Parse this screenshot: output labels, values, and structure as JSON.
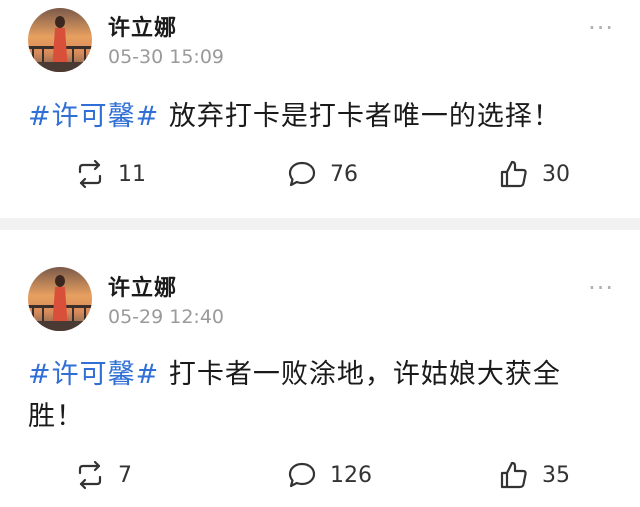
{
  "posts": [
    {
      "author": "许立娜",
      "time": "05-30 15:09",
      "more_icon": "more-dots-icon",
      "hashtag": "#许可馨#",
      "text": " 放弃打卡是打卡者唯一的选择！",
      "repost_count": "11",
      "comment_count": "76",
      "like_count": "30"
    },
    {
      "author": "许立娜",
      "time": "05-29 12:40",
      "more_icon": "more-dots-icon",
      "hashtag": "#许可馨#",
      "text": " 打卡者一败涂地，许姑娘大获全胜！",
      "repost_count": "7",
      "comment_count": "126",
      "like_count": "35"
    }
  ],
  "icons": {
    "repost": "repost-icon",
    "comment": "comment-icon",
    "like": "thumbs-up-icon"
  },
  "colors": {
    "hashtag": "#2f6fd6",
    "timestamp": "#9a9a9a",
    "divider": "#f2f2f2"
  }
}
